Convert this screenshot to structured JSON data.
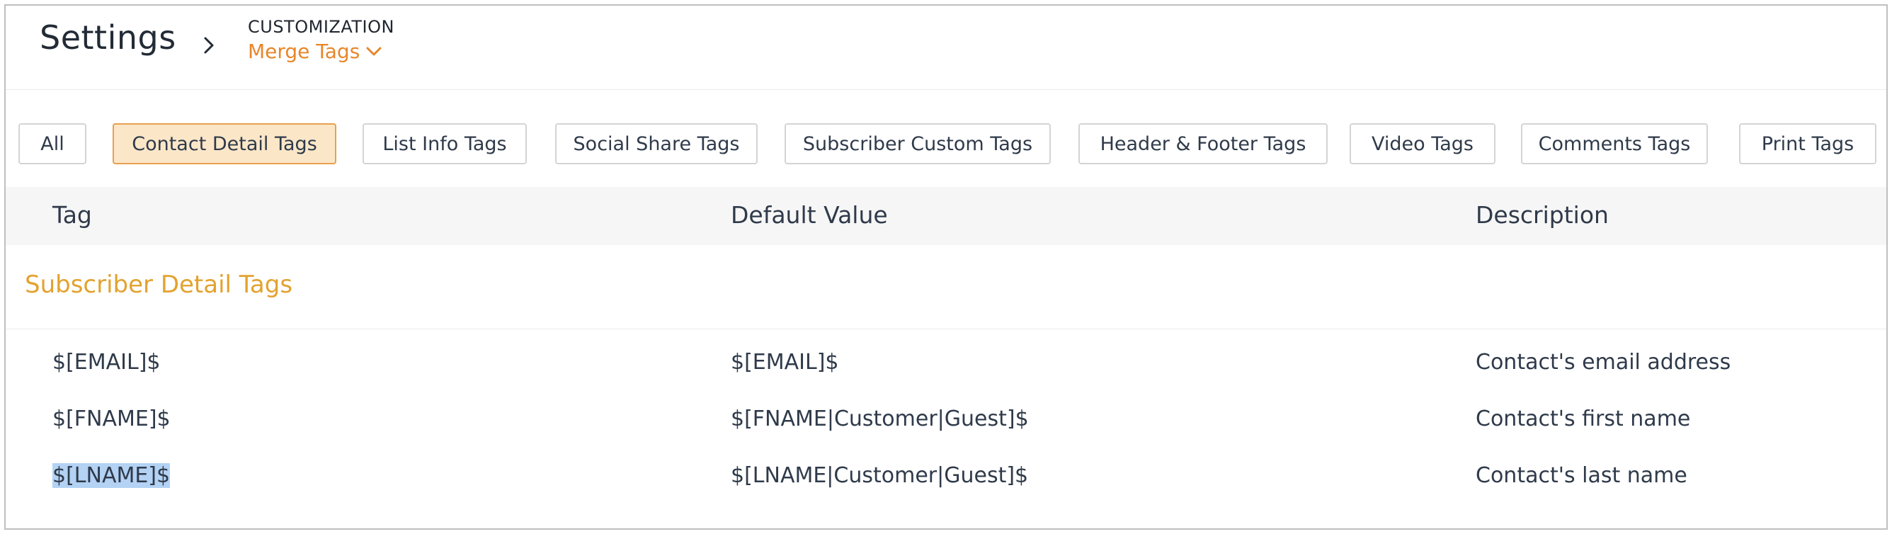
{
  "header": {
    "title": "Settings",
    "section": "CUSTOMIZATION",
    "current_page": "Merge Tags"
  },
  "filters": [
    {
      "label": "All",
      "active": false
    },
    {
      "label": "Contact Detail Tags",
      "active": true
    },
    {
      "label": "List Info Tags",
      "active": false
    },
    {
      "label": "Social Share Tags",
      "active": false
    },
    {
      "label": "Subscriber Custom Tags",
      "active": false
    },
    {
      "label": "Header & Footer Tags",
      "active": false
    },
    {
      "label": "Video Tags",
      "active": false
    },
    {
      "label": "Comments Tags",
      "active": false
    },
    {
      "label": "Print Tags",
      "active": false
    }
  ],
  "table": {
    "columns": [
      "Tag",
      "Default Value",
      "Description"
    ],
    "group_title": "Subscriber Detail Tags",
    "rows": [
      {
        "tag": "$[EMAIL]$",
        "default": "$[EMAIL]$",
        "description": "Contact's email address"
      },
      {
        "tag": "$[FNAME]$",
        "default": "$[FNAME|Customer|Guest]$",
        "description": "Contact's first name"
      },
      {
        "tag": "$[LNAME]$",
        "default": "$[LNAME|Customer|Guest]$",
        "description": "Contact's last name"
      }
    ]
  },
  "colors": {
    "accent_orange": "#e8862a",
    "group_title": "#e3a22f",
    "active_filter_bg": "#fbe7c8",
    "active_filter_border": "#e8a050",
    "selection_highlight": "#b3d2f4"
  },
  "icons": {
    "breadcrumb_separator": "chevron-right-icon",
    "dropdown": "chevron-down-icon"
  }
}
